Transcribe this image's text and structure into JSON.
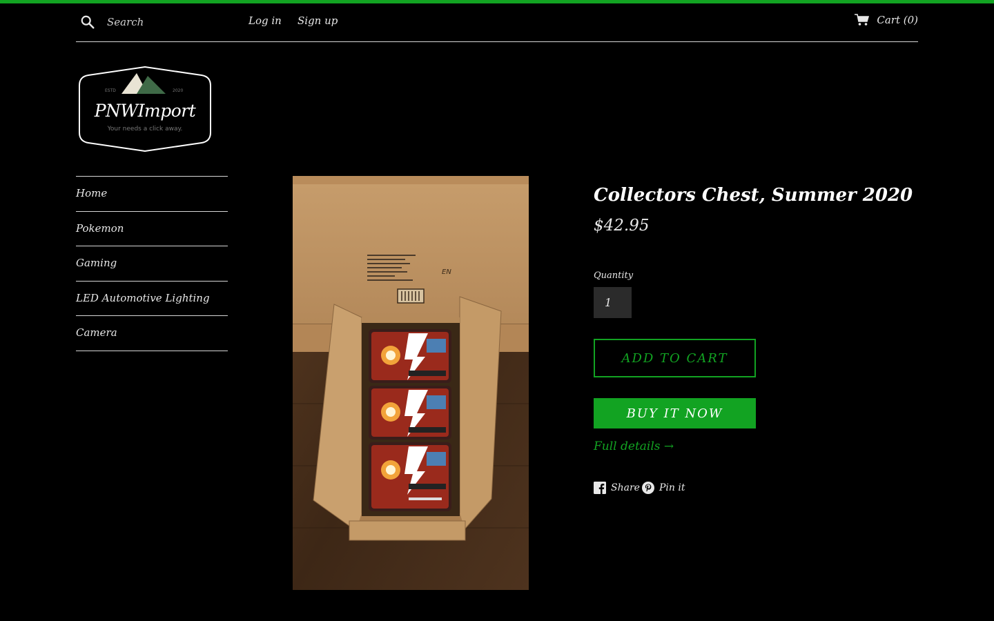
{
  "colors": {
    "accent": "#12a322",
    "background": "#000000",
    "text": "#e8e8e8"
  },
  "header": {
    "search_placeholder": "Search",
    "login": "Log in",
    "signup": "Sign up",
    "cart": "Cart (0)",
    "icons": {
      "search": "search-icon",
      "cart": "cart-icon"
    }
  },
  "logo": {
    "name": "PNWImport",
    "tagline": "Your needs a click away.",
    "est": "ESTD",
    "year": "2020"
  },
  "sidebar": {
    "items": [
      {
        "label": "Home"
      },
      {
        "label": "Pokemon"
      },
      {
        "label": "Gaming"
      },
      {
        "label": "LED Automotive Lighting"
      },
      {
        "label": "Camera"
      }
    ]
  },
  "product": {
    "title": "Collectors Chest, Summer 2020",
    "price": "$42.95",
    "quantity_label": "Quantity",
    "quantity_value": "1",
    "add_to_cart": "ADD TO CART",
    "buy_now": "BUY IT NOW",
    "full_details": "Full details →",
    "share_facebook": "Share",
    "share_pinterest": "Pin it",
    "image_alt": "Cardboard shipping box containing Pokemon Collectors Chest tins",
    "image_text": {
      "box_label": "EN"
    }
  }
}
